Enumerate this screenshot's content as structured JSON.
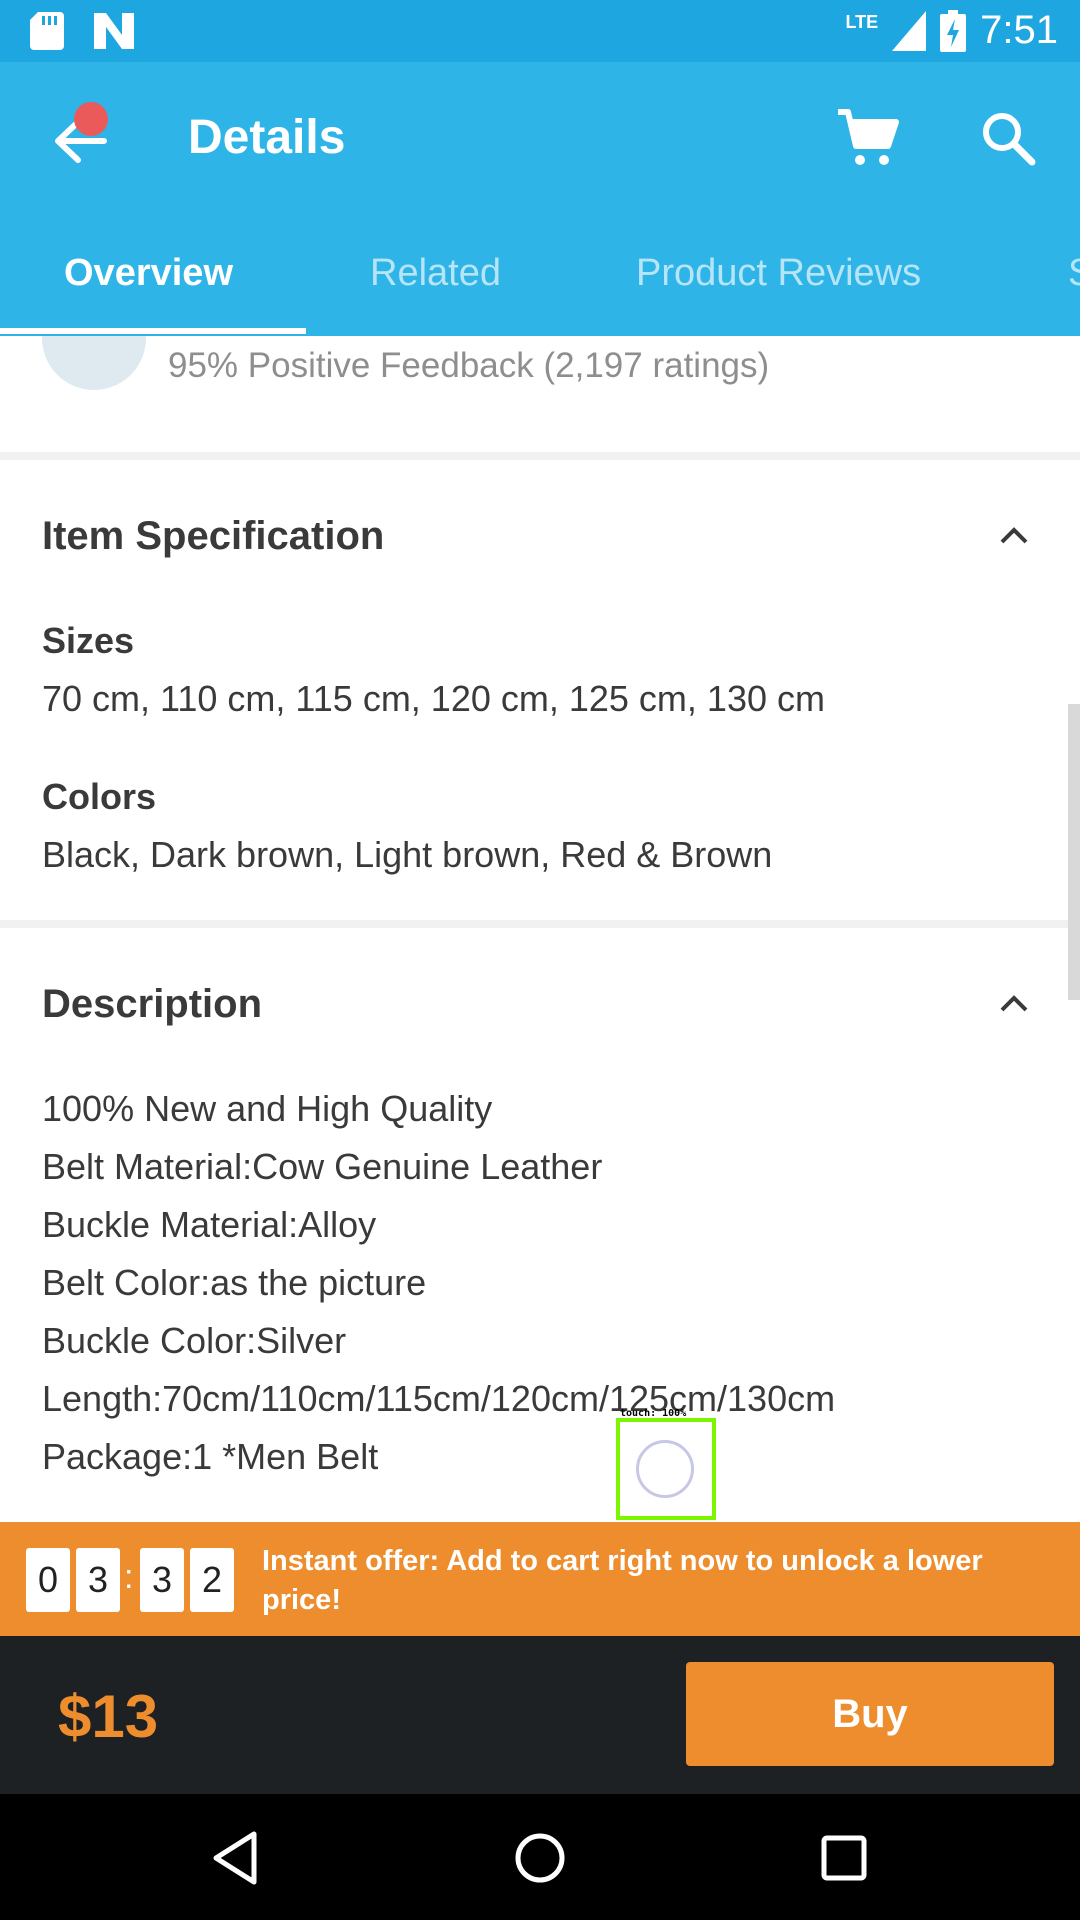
{
  "status_bar": {
    "network": "LTE",
    "time": "7:51"
  },
  "app_bar": {
    "title": "Details"
  },
  "tabs": [
    {
      "label": "Overview",
      "active": true
    },
    {
      "label": "Related"
    },
    {
      "label": "Product Reviews"
    },
    {
      "label": "S"
    }
  ],
  "seller": {
    "feedback": "95% Positive Feedback (2,197 ratings)"
  },
  "spec": {
    "heading": "Item Specification",
    "sizes_label": "Sizes",
    "sizes_value": "70 cm, 110 cm, 115 cm, 120 cm, 125 cm, 130 cm",
    "colors_label": "Colors",
    "colors_value": "Black, Dark brown, Light brown, Red & Brown"
  },
  "description": {
    "heading": "Description",
    "lines": [
      "100% New and High Quality",
      "Belt Material:Cow Genuine Leather",
      "Buckle Material:Alloy",
      "Belt Color:as the picture",
      "Buckle Color:Silver",
      "Length:70cm/110cm/115cm/120cm/125cm/130cm",
      "Package:1 *Men Belt"
    ]
  },
  "touch_overlay": {
    "label": "touch: 100%"
  },
  "offer": {
    "timer": [
      "0",
      "3",
      "3",
      "2"
    ],
    "separator": ":",
    "text": "Instant offer: Add to cart right now to unlock a lower price!"
  },
  "purchase": {
    "price": "$13",
    "buy_label": "Buy"
  },
  "colors": {
    "primary": "#2fb4e7",
    "accent": "#ee8d2d",
    "dark": "#1e2124"
  }
}
